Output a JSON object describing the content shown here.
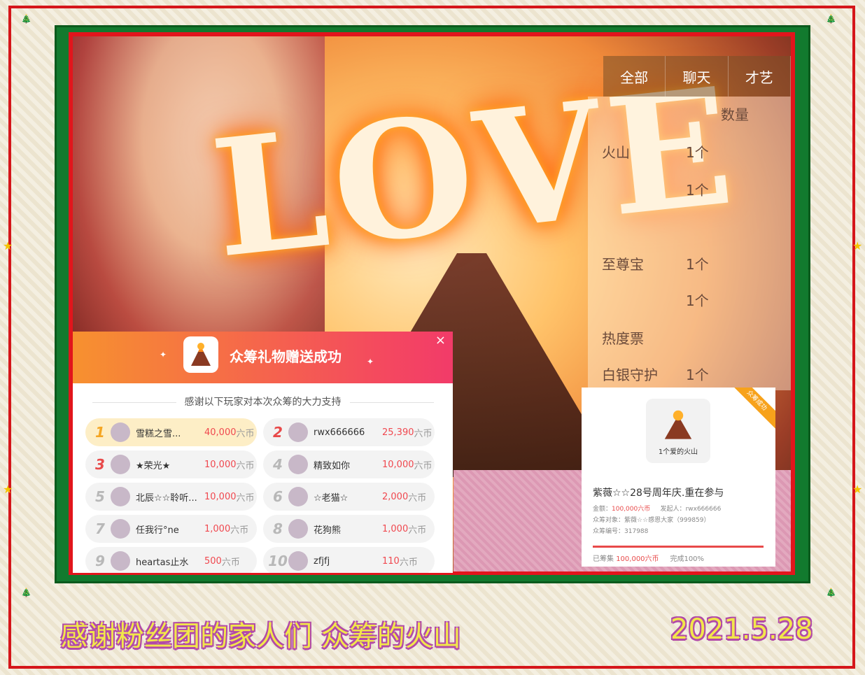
{
  "live": {
    "tabs": [
      "全部",
      "聊天",
      "才艺"
    ],
    "gift_list_header": "数量",
    "gift_rows": [
      {
        "name": "火山",
        "count": "1个"
      },
      {
        "name": "",
        "count": "1个"
      },
      {
        "name": "至尊宝",
        "count": "1个"
      },
      {
        "name": "",
        "count": "1个"
      },
      {
        "name": "热度票",
        "count": ""
      },
      {
        "name": "白银守护",
        "count": "1个"
      }
    ]
  },
  "popup": {
    "title": "众筹礼物赠送成功",
    "close": "×",
    "subtitle": "感谢以下玩家对本次众筹的大力支持",
    "unit": "六币",
    "ranks": [
      {
        "n": "1",
        "name": "雪糕之雪...",
        "amount": "40,000"
      },
      {
        "n": "2",
        "name": "rwx666666",
        "amount": "25,390"
      },
      {
        "n": "3",
        "name": "★荣光★",
        "amount": "10,000"
      },
      {
        "n": "4",
        "name": "精致如你",
        "amount": "10,000"
      },
      {
        "n": "5",
        "name": "北辰☆☆聆听...",
        "amount": "10,000"
      },
      {
        "n": "6",
        "name": "☆老猫☆",
        "amount": "2,000"
      },
      {
        "n": "7",
        "name": "任我行°ne",
        "amount": "1,000"
      },
      {
        "n": "8",
        "name": "花狗熊",
        "amount": "1,000"
      },
      {
        "n": "9",
        "name": "heartas止水",
        "amount": "500"
      },
      {
        "n": "10",
        "name": "zfjfj",
        "amount": "110"
      }
    ]
  },
  "card": {
    "ribbon": "众筹成功",
    "gift_label": "1个爱的火山",
    "title": "紫薇☆☆28号周年庆.重在参与",
    "amount_label": "金额：",
    "amount_value": "100,000六币",
    "initiator_label": "发起人：",
    "initiator_value": "rwx666666",
    "target_label": "众筹对象：",
    "target_value": "紫薇☆☆感恩大家（999859）",
    "id_label": "众筹编号：",
    "id_value": "317988",
    "raised_label": "已筹集",
    "raised_value": "100,000六币",
    "complete_label": "完成100%",
    "progress": 1.0
  },
  "caption": {
    "left": "感谢粉丝团的家人们 众筹的火山",
    "right": "2021.5.28"
  },
  "decor": {
    "love_text": "LOVE"
  },
  "colors": {
    "frame_red": "#d5161a",
    "frame_green": "#127a2e",
    "accent": "#e84a4a",
    "caption_yellow": "#f2e74a",
    "caption_purple": "#b24aa8"
  }
}
